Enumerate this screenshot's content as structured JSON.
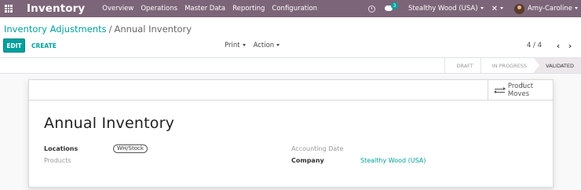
{
  "navbar": {
    "brand": "Inventory",
    "menu": [
      "Overview",
      "Operations",
      "Master Data",
      "Reporting",
      "Configuration"
    ],
    "chat_count": "3",
    "company": "Stealthy Wood (USA)",
    "user": "Amy-Caroline"
  },
  "breadcrumb": {
    "parent": "Inventory Adjustments",
    "separator": "/",
    "current": "Annual Inventory"
  },
  "buttons": {
    "edit": "EDIT",
    "create": "CREATE",
    "print": "Print",
    "action": "Action"
  },
  "pager": {
    "counter": "4 / 4",
    "prev": "‹",
    "next": "›"
  },
  "statusbar": {
    "stages": [
      "DRAFT",
      "IN PROGRESS",
      "VALIDATED"
    ],
    "active": "VALIDATED"
  },
  "smart_button": {
    "label": "Product Moves"
  },
  "record": {
    "title": "Annual Inventory",
    "locations_label": "Locations",
    "locations_tag": "WH/Stock",
    "products_label": "Products",
    "accounting_date_label": "Accounting Date",
    "company_label": "Company",
    "company_value": "Stealthy Wood (USA)"
  },
  "colors": {
    "navbar": "#7c6578",
    "accent": "#00a09d"
  }
}
